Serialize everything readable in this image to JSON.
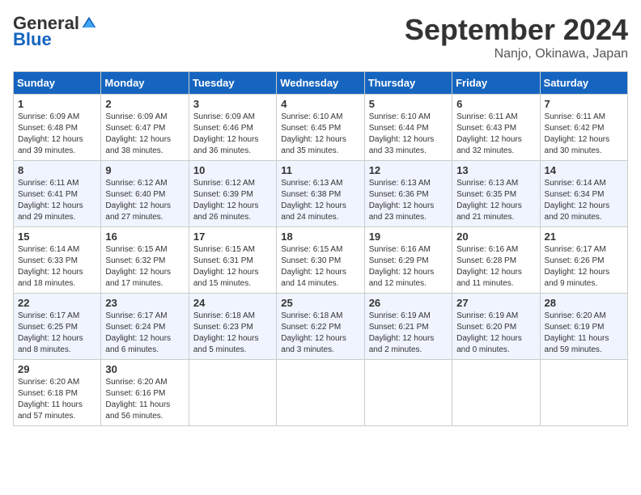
{
  "header": {
    "logo_general": "General",
    "logo_blue": "Blue",
    "title": "September 2024",
    "location": "Nanjo, Okinawa, Japan"
  },
  "days_of_week": [
    "Sunday",
    "Monday",
    "Tuesday",
    "Wednesday",
    "Thursday",
    "Friday",
    "Saturday"
  ],
  "weeks": [
    {
      "days": [
        {
          "num": "1",
          "sunrise": "Sunrise: 6:09 AM",
          "sunset": "Sunset: 6:48 PM",
          "daylight": "Daylight: 12 hours and 39 minutes."
        },
        {
          "num": "2",
          "sunrise": "Sunrise: 6:09 AM",
          "sunset": "Sunset: 6:47 PM",
          "daylight": "Daylight: 12 hours and 38 minutes."
        },
        {
          "num": "3",
          "sunrise": "Sunrise: 6:09 AM",
          "sunset": "Sunset: 6:46 PM",
          "daylight": "Daylight: 12 hours and 36 minutes."
        },
        {
          "num": "4",
          "sunrise": "Sunrise: 6:10 AM",
          "sunset": "Sunset: 6:45 PM",
          "daylight": "Daylight: 12 hours and 35 minutes."
        },
        {
          "num": "5",
          "sunrise": "Sunrise: 6:10 AM",
          "sunset": "Sunset: 6:44 PM",
          "daylight": "Daylight: 12 hours and 33 minutes."
        },
        {
          "num": "6",
          "sunrise": "Sunrise: 6:11 AM",
          "sunset": "Sunset: 6:43 PM",
          "daylight": "Daylight: 12 hours and 32 minutes."
        },
        {
          "num": "7",
          "sunrise": "Sunrise: 6:11 AM",
          "sunset": "Sunset: 6:42 PM",
          "daylight": "Daylight: 12 hours and 30 minutes."
        }
      ]
    },
    {
      "days": [
        {
          "num": "8",
          "sunrise": "Sunrise: 6:11 AM",
          "sunset": "Sunset: 6:41 PM",
          "daylight": "Daylight: 12 hours and 29 minutes."
        },
        {
          "num": "9",
          "sunrise": "Sunrise: 6:12 AM",
          "sunset": "Sunset: 6:40 PM",
          "daylight": "Daylight: 12 hours and 27 minutes."
        },
        {
          "num": "10",
          "sunrise": "Sunrise: 6:12 AM",
          "sunset": "Sunset: 6:39 PM",
          "daylight": "Daylight: 12 hours and 26 minutes."
        },
        {
          "num": "11",
          "sunrise": "Sunrise: 6:13 AM",
          "sunset": "Sunset: 6:38 PM",
          "daylight": "Daylight: 12 hours and 24 minutes."
        },
        {
          "num": "12",
          "sunrise": "Sunrise: 6:13 AM",
          "sunset": "Sunset: 6:36 PM",
          "daylight": "Daylight: 12 hours and 23 minutes."
        },
        {
          "num": "13",
          "sunrise": "Sunrise: 6:13 AM",
          "sunset": "Sunset: 6:35 PM",
          "daylight": "Daylight: 12 hours and 21 minutes."
        },
        {
          "num": "14",
          "sunrise": "Sunrise: 6:14 AM",
          "sunset": "Sunset: 6:34 PM",
          "daylight": "Daylight: 12 hours and 20 minutes."
        }
      ]
    },
    {
      "days": [
        {
          "num": "15",
          "sunrise": "Sunrise: 6:14 AM",
          "sunset": "Sunset: 6:33 PM",
          "daylight": "Daylight: 12 hours and 18 minutes."
        },
        {
          "num": "16",
          "sunrise": "Sunrise: 6:15 AM",
          "sunset": "Sunset: 6:32 PM",
          "daylight": "Daylight: 12 hours and 17 minutes."
        },
        {
          "num": "17",
          "sunrise": "Sunrise: 6:15 AM",
          "sunset": "Sunset: 6:31 PM",
          "daylight": "Daylight: 12 hours and 15 minutes."
        },
        {
          "num": "18",
          "sunrise": "Sunrise: 6:15 AM",
          "sunset": "Sunset: 6:30 PM",
          "daylight": "Daylight: 12 hours and 14 minutes."
        },
        {
          "num": "19",
          "sunrise": "Sunrise: 6:16 AM",
          "sunset": "Sunset: 6:29 PM",
          "daylight": "Daylight: 12 hours and 12 minutes."
        },
        {
          "num": "20",
          "sunrise": "Sunrise: 6:16 AM",
          "sunset": "Sunset: 6:28 PM",
          "daylight": "Daylight: 12 hours and 11 minutes."
        },
        {
          "num": "21",
          "sunrise": "Sunrise: 6:17 AM",
          "sunset": "Sunset: 6:26 PM",
          "daylight": "Daylight: 12 hours and 9 minutes."
        }
      ]
    },
    {
      "days": [
        {
          "num": "22",
          "sunrise": "Sunrise: 6:17 AM",
          "sunset": "Sunset: 6:25 PM",
          "daylight": "Daylight: 12 hours and 8 minutes."
        },
        {
          "num": "23",
          "sunrise": "Sunrise: 6:17 AM",
          "sunset": "Sunset: 6:24 PM",
          "daylight": "Daylight: 12 hours and 6 minutes."
        },
        {
          "num": "24",
          "sunrise": "Sunrise: 6:18 AM",
          "sunset": "Sunset: 6:23 PM",
          "daylight": "Daylight: 12 hours and 5 minutes."
        },
        {
          "num": "25",
          "sunrise": "Sunrise: 6:18 AM",
          "sunset": "Sunset: 6:22 PM",
          "daylight": "Daylight: 12 hours and 3 minutes."
        },
        {
          "num": "26",
          "sunrise": "Sunrise: 6:19 AM",
          "sunset": "Sunset: 6:21 PM",
          "daylight": "Daylight: 12 hours and 2 minutes."
        },
        {
          "num": "27",
          "sunrise": "Sunrise: 6:19 AM",
          "sunset": "Sunset: 6:20 PM",
          "daylight": "Daylight: 12 hours and 0 minutes."
        },
        {
          "num": "28",
          "sunrise": "Sunrise: 6:20 AM",
          "sunset": "Sunset: 6:19 PM",
          "daylight": "Daylight: 11 hours and 59 minutes."
        }
      ]
    },
    {
      "days": [
        {
          "num": "29",
          "sunrise": "Sunrise: 6:20 AM",
          "sunset": "Sunset: 6:18 PM",
          "daylight": "Daylight: 11 hours and 57 minutes."
        },
        {
          "num": "30",
          "sunrise": "Sunrise: 6:20 AM",
          "sunset": "Sunset: 6:16 PM",
          "daylight": "Daylight: 11 hours and 56 minutes."
        },
        null,
        null,
        null,
        null,
        null
      ]
    }
  ]
}
